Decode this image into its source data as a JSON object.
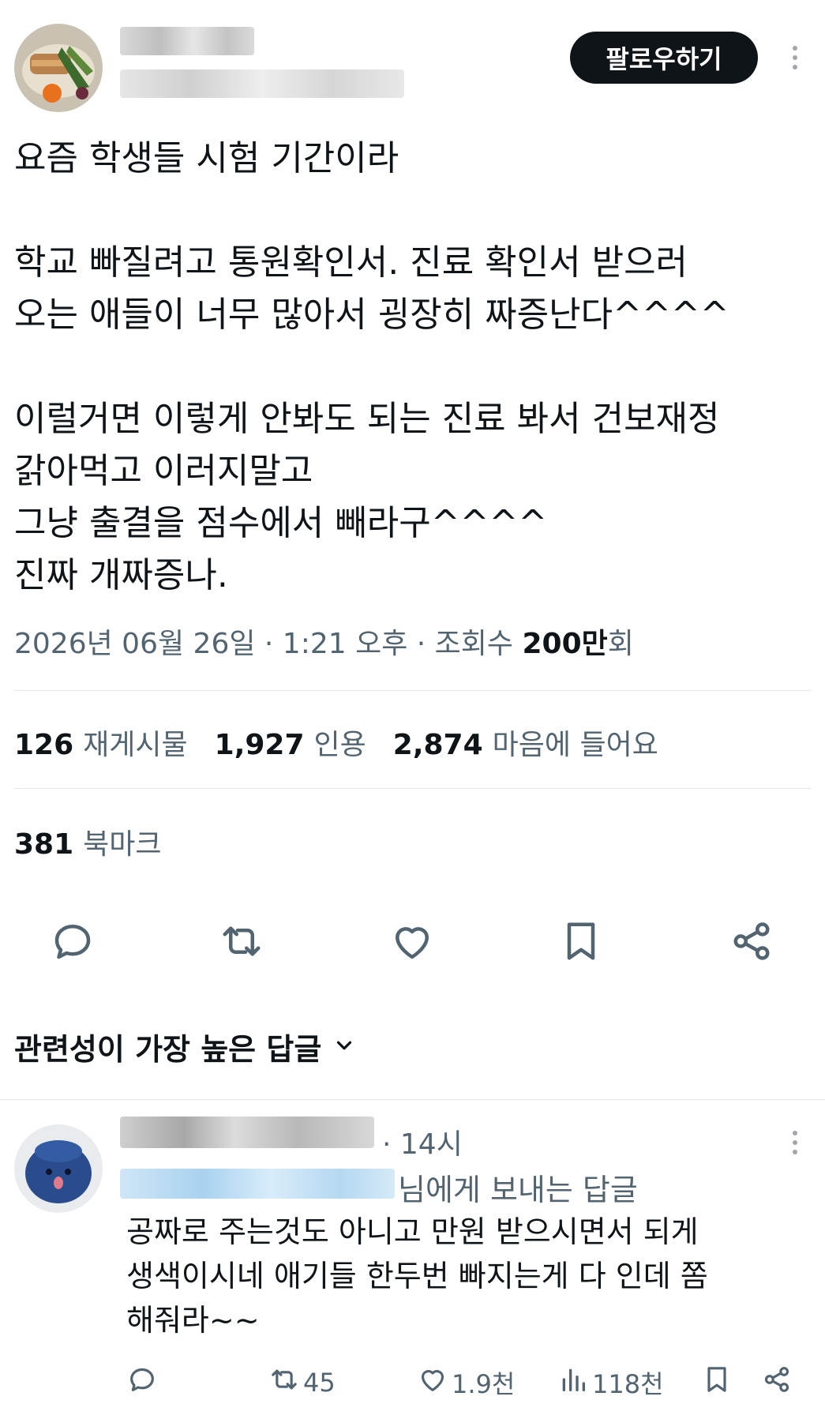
{
  "header": {
    "follow_label": "팔로우하기"
  },
  "tweet": {
    "lines": [
      "요즘 학생들 시험 기간이라",
      "",
      "학교 빠질려고 통원확인서. 진료 확인서 받으러",
      "오는 애들이 너무 많아서 굉장히 짜증난다^^^^",
      "",
      "이럴거면 이렇게 안봐도 되는 진료 봐서 건보재정",
      "갉아먹고 이러지말고",
      "그냥 출결을 점수에서 빼라구^^^^",
      "진짜 개짜증나."
    ],
    "meta_prefix": "2026년 06월 26일 · 1:21 오후 · 조회수 ",
    "meta_views": "200만",
    "meta_suffix": "회"
  },
  "stats": {
    "reposts_num": "126",
    "reposts_label": "재게시물",
    "quotes_num": "1,927",
    "quotes_label": "인용",
    "likes_num": "2,874",
    "likes_label": "마음에 들어요",
    "bookmarks_num": "381",
    "bookmarks_label": "북마크"
  },
  "actions": [
    "reply-icon",
    "repost-icon",
    "like-icon",
    "bookmark-icon",
    "share-icon"
  ],
  "replies_header": {
    "label": "관련성이 가장 높은 답글"
  },
  "reply": {
    "time": "· 14시",
    "reply_to_suffix": "님에게 보내는 답글",
    "lines": [
      "공짜로 주는것도 아니고 만원 받으시면서 되게",
      "생색이시네 애기들 한두번 빠지는게 다 인데 쫌",
      "해줘라~~"
    ],
    "reposts": "45",
    "likes": "1.9천",
    "views": "118천"
  },
  "colors": {
    "text": "#0f1419",
    "secondary": "#536471",
    "divider": "#e3e7ea",
    "button_bg": "#0f1419"
  }
}
